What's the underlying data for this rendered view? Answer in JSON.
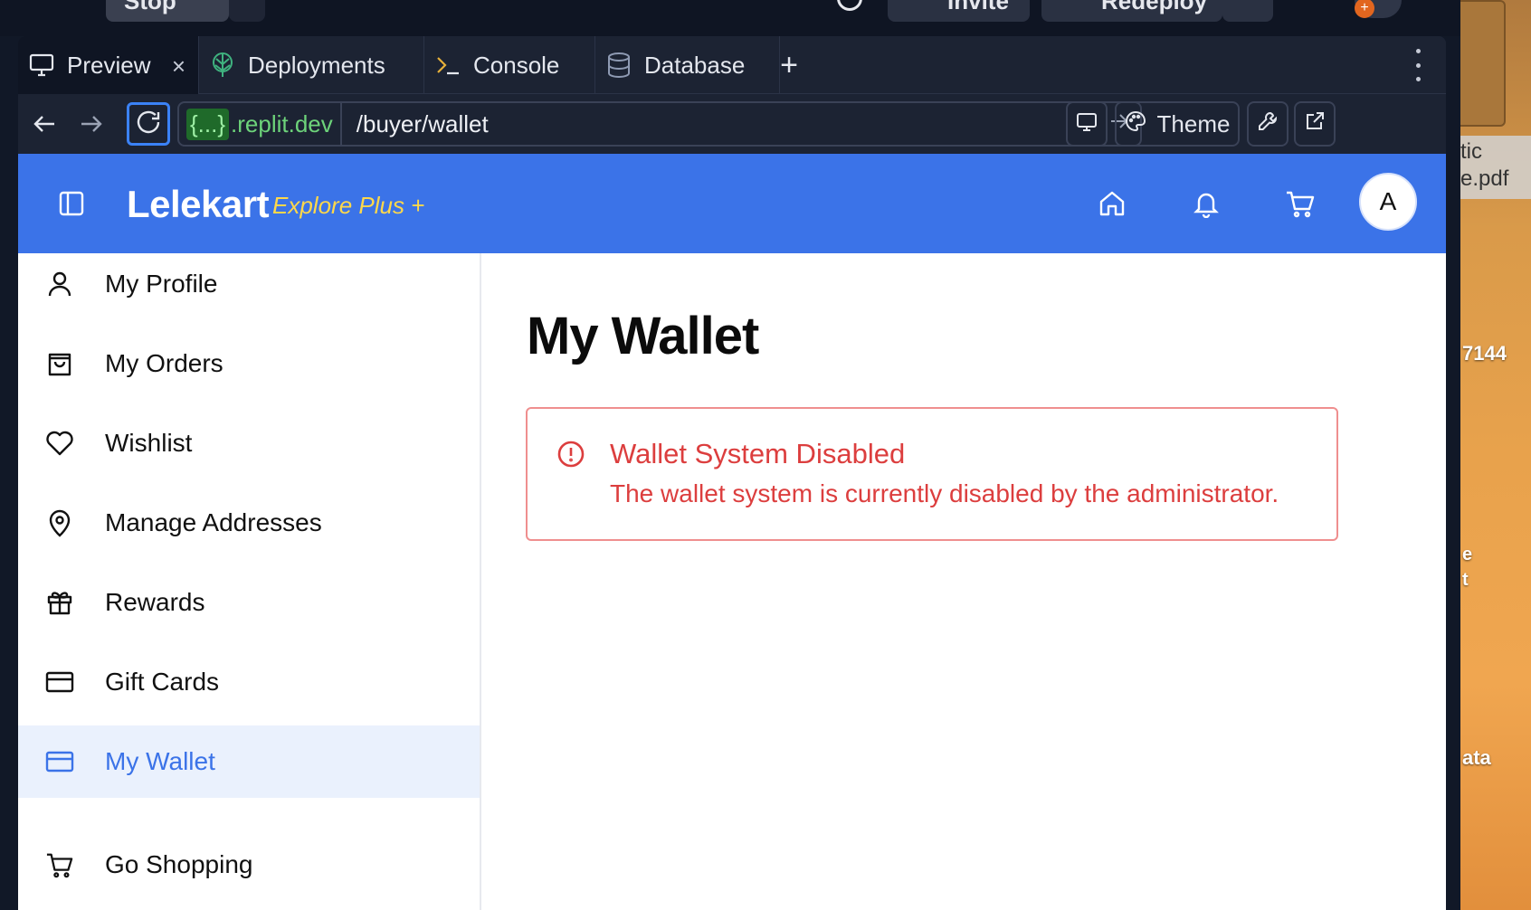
{
  "topbar": {
    "stop_label": "Stop",
    "invite_label": "Invite",
    "redeploy_label": "Redeploy",
    "notification_badge": "+"
  },
  "desktop": {
    "frag1": "tic",
    "frag2": "e.pdf",
    "frag3": "7144",
    "frag4": "e",
    "frag5": "t",
    "frag6": "ata"
  },
  "tabs": [
    {
      "label": "Preview",
      "icon": "monitor-icon",
      "active": true
    },
    {
      "label": "Deployments",
      "icon": "deployments-icon"
    },
    {
      "label": "Console",
      "icon": "terminal-icon"
    },
    {
      "label": "Database",
      "icon": "database-icon"
    }
  ],
  "urlbar": {
    "domain_braces": "{...}",
    "domain": ".replit.dev",
    "path": "/buyer/wallet",
    "theme_label": "Theme"
  },
  "app": {
    "brand": "Lelekart",
    "brand_sub": "Explore Plus +",
    "avatar_letter": "A",
    "accent_color": "#3b73e8",
    "sidebar": [
      {
        "label": "My Profile",
        "icon": "user-icon"
      },
      {
        "label": "My Orders",
        "icon": "shopping-bag-icon"
      },
      {
        "label": "Wishlist",
        "icon": "heart-icon"
      },
      {
        "label": "Manage Addresses",
        "icon": "map-pin-icon"
      },
      {
        "label": "Rewards",
        "icon": "gift-icon"
      },
      {
        "label": "Gift Cards",
        "icon": "credit-card-icon"
      },
      {
        "label": "My Wallet",
        "icon": "credit-card-icon",
        "active": true
      },
      {
        "label": "Go Shopping",
        "icon": "cart-icon"
      }
    ],
    "main": {
      "title": "My Wallet",
      "alert": {
        "title": "Wallet System Disabled",
        "description": "The wallet system is currently disabled by the administrator.",
        "color": "#dc3e3e"
      }
    }
  }
}
